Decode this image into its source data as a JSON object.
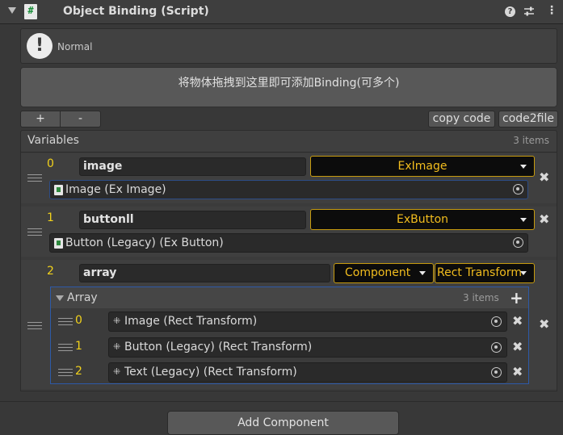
{
  "component": {
    "title": "Object Binding (Script)",
    "script_icon_glyph": "#",
    "help_glyph": "?",
    "more_glyph": "⋮"
  },
  "info": {
    "icon_glyph": "!",
    "text": "Normal"
  },
  "drop_area": {
    "text": "将物体拖拽到这里即可添加Binding(可多个)"
  },
  "toolbar": {
    "plus_label": "+",
    "minus_label": "-",
    "copy_code_label": "copy code",
    "code2file_label": "code2file"
  },
  "variables": {
    "title": "Variables",
    "count": "3 items",
    "items": [
      {
        "index": "0",
        "name": "image",
        "type": "ExImage",
        "object": "Image (Ex Image)"
      },
      {
        "index": "1",
        "name": "buttonll",
        "type": "ExButton",
        "object": "Button (Legacy) (Ex Button)"
      },
      {
        "index": "2",
        "name": "array",
        "type": "Component",
        "subtype": "Rect Transform",
        "array": {
          "title": "Array",
          "count": "3 items",
          "add_glyph": "+",
          "elements": [
            {
              "index": "0",
              "object": "Image (Rect Transform)"
            },
            {
              "index": "1",
              "object": "Button (Legacy) (Rect Transform)"
            },
            {
              "index": "2",
              "object": "Text (Legacy) (Rect Transform)"
            }
          ]
        }
      }
    ]
  },
  "remove_glyph": "✖",
  "add_component_label": "Add Component",
  "colors": {
    "accent_yellow": "#f2bd1e",
    "index_yellow": "#f2d21b",
    "selection_blue": "#2d5aa8"
  }
}
